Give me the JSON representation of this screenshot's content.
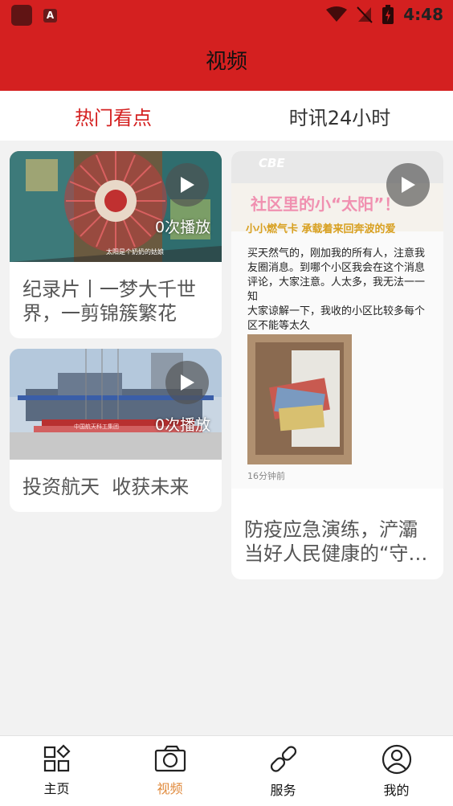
{
  "status_bar": {
    "time": "4:48",
    "app_badge": "A"
  },
  "header": {
    "title": "视频"
  },
  "tabs": [
    {
      "label": "热门看点",
      "active": true
    },
    {
      "label": "时讯24小时",
      "active": false
    }
  ],
  "cards": [
    {
      "title": "纪录片丨一梦大千世界，一剪锦簇繁花",
      "play_count": "0次播放",
      "caption": "太阳是个奶奶的姑娘"
    },
    {
      "title": "投资航天  收获未来",
      "play_count": "0次播放",
      "sign_text": "中国航天科工集团"
    },
    {
      "title": "防疫应急演练，浐灞当好人民健康的“守…",
      "logo_text": "CBE",
      "poster_headline": "社区里的小“太阳”！",
      "poster_sub": "小小燃气卡 承载着来回奔波的爱",
      "poster_body": [
        "买天然气的，刚加我的所有人，注意我",
        "友圈消息。到哪个小区我会在这个消息",
        "评论，大家注意。人太多，我无法一一",
        "知",
        "大家谅解一下，我收的小区比较多每个",
        "区不能等太久"
      ],
      "poster_time": "16分钟前"
    }
  ],
  "bottom_nav": [
    {
      "label": "主页",
      "icon": "home-grid-icon",
      "active": false
    },
    {
      "label": "视频",
      "icon": "camera-icon",
      "active": true
    },
    {
      "label": "服务",
      "icon": "link-icon",
      "active": false
    },
    {
      "label": "我的",
      "icon": "user-icon",
      "active": false
    }
  ],
  "colors": {
    "brand_red": "#d42020",
    "nav_active": "#e08a3c"
  }
}
